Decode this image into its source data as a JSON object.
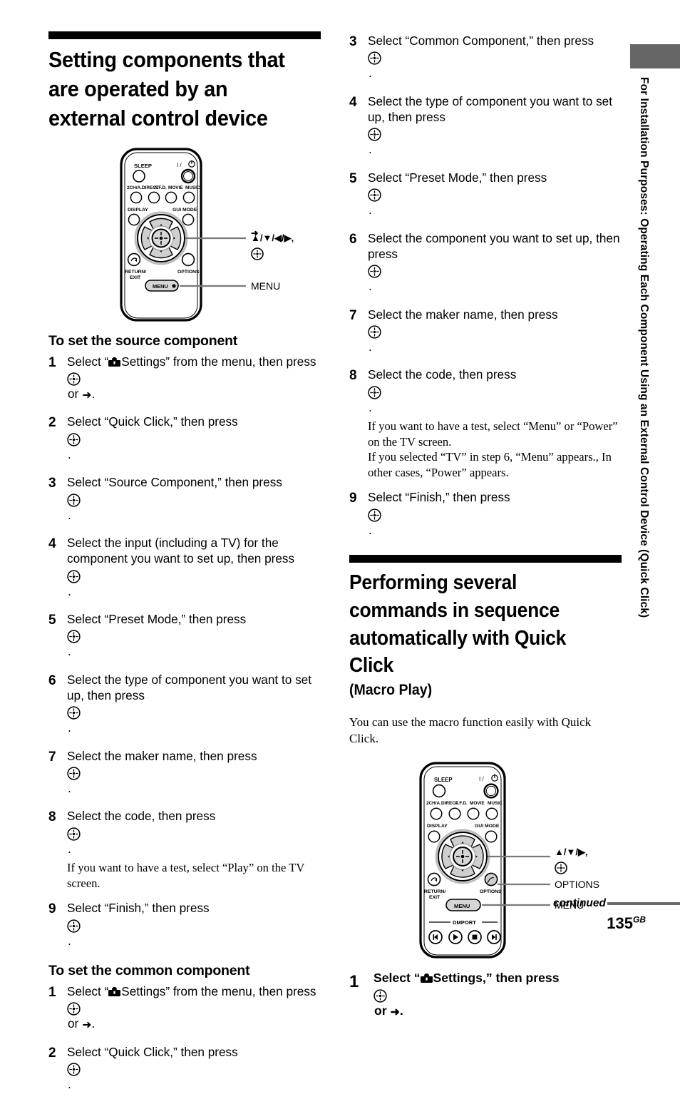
{
  "side": {
    "vertical_title": "For Installation Purposes: Operating Each Component Using an External Control Device (Quick Click)",
    "tab_color": "#666666"
  },
  "left_column": {
    "chapter_title": "Setting components that are operated by an external control device",
    "remote": {
      "buttons": {
        "sleep": "SLEEP",
        "power": "I / ⏻",
        "row2": [
          "2CH/A.DIRECT",
          "A.F.D.",
          "MOVIE",
          "MUSIC"
        ],
        "display": "DISPLAY",
        "gui_mode": "GUI MODE",
        "return_exit": "RETURN/\nEXIT",
        "options": "OPTIONS",
        "menu": "MENU"
      },
      "callouts": [
        {
          "label": "↑/↓/←/→,",
          "has_enter_icon": true
        },
        {
          "label": "MENU",
          "has_enter_icon": false
        }
      ]
    },
    "section1_title": "To set the source component",
    "section1_steps": [
      {
        "num": "1",
        "pre": "Select “",
        "icon": "toolbox",
        "mid": "Settings” from the menu, then press ",
        "enter": true,
        "post": " or ",
        "arrow": true,
        "end": "."
      },
      {
        "num": "2",
        "text_a": "Select “Quick Click,” then press ",
        "enter": true,
        "text_b": " ."
      },
      {
        "num": "3",
        "text_a": "Select “Source Component,” then press ",
        "enter": true,
        "text_b": " ."
      },
      {
        "num": "4",
        "text_a": "Select the input (including a TV) for the component you want to set up, then press ",
        "enter": true,
        "text_b": " ."
      },
      {
        "num": "5",
        "text_a": "Select “Preset Mode,” then press ",
        "enter": true,
        "text_b": " ."
      },
      {
        "num": "6",
        "text_a": "Select the type of component you want to set up, then press ",
        "enter": true,
        "text_b": " ."
      },
      {
        "num": "7",
        "text_a": "Select the maker name, then press ",
        "enter": true,
        "text_b": " ."
      },
      {
        "num": "8",
        "text_a": "Select the code, then press ",
        "enter": true,
        "text_b": " .",
        "note": "If you want to have a test, select “Play” on the TV screen."
      },
      {
        "num": "9",
        "text_a": "Select “Finish,” then press ",
        "enter": true,
        "text_b": " ."
      }
    ],
    "section2_title": "To set the common component",
    "section2_steps": [
      {
        "num": "1",
        "pre": "Select “",
        "icon": "toolbox",
        "mid": "Settings” from the menu, then press ",
        "enter": true,
        "post": " or ",
        "arrow": true,
        "end": "."
      },
      {
        "num": "2",
        "text_a": "Select “Quick Click,” then press ",
        "enter": true,
        "text_b": " ."
      }
    ]
  },
  "right_column": {
    "common_steps": [
      {
        "num": "3",
        "text_a": "Select “Common Component,” then press ",
        "enter": true,
        "text_b": " ."
      },
      {
        "num": "4",
        "text_a": "Select the type of component you want to set up, then press ",
        "enter": true,
        "text_b": " ."
      },
      {
        "num": "5",
        "text_a": "Select “Preset Mode,” then press ",
        "enter": true,
        "text_b": " ."
      },
      {
        "num": "6",
        "text_a": "Select the component you want to set up, then press ",
        "enter": true,
        "text_b": " ."
      },
      {
        "num": "7",
        "text_a": "Select the maker name, then press ",
        "enter": true,
        "text_b": " ."
      },
      {
        "num": "8",
        "text_a": "Select the code, then press ",
        "enter": true,
        "text_b": " .",
        "note": "If you want to have a test, select “Menu” or “Power” on the TV screen.\nIf you selected “TV” in step 6, “Menu” appears., In other cases, “Power” appears."
      },
      {
        "num": "9",
        "text_a": "Select “Finish,” then press ",
        "enter": true,
        "text_b": " ."
      }
    ],
    "chapter_title": "Performing several commands in sequence automatically with Quick Click",
    "chapter_subtitle": "(Macro Play)",
    "intro": "You can use the macro function easily with Quick Click.",
    "remote": {
      "buttons": {
        "sleep": "SLEEP",
        "power": "I / ⏻",
        "row2": [
          "2CH/A.DIRECT",
          "A.F.D.",
          "MOVIE",
          "MUSIC"
        ],
        "display": "DISPLAY",
        "gui_mode": "GUI MODE",
        "return_exit": "RETURN/\nEXIT",
        "options": "OPTIONS",
        "menu": "MENU",
        "dmport": "DMPORT"
      },
      "callouts": [
        {
          "label": "↑/↓/→,",
          "has_enter_icon": true
        },
        {
          "label": "OPTIONS",
          "has_enter_icon": false
        },
        {
          "label": "MENU",
          "has_enter_icon": false
        }
      ]
    },
    "macro_steps": [
      {
        "num": "1",
        "pre": "Select “",
        "icon": "toolbox",
        "mid": "Settings,” then press ",
        "enter": true,
        "post": " or ",
        "arrow": true,
        "end": "."
      }
    ]
  },
  "footer": {
    "continued": "continued",
    "page_number": "135",
    "page_suffix": "GB"
  }
}
